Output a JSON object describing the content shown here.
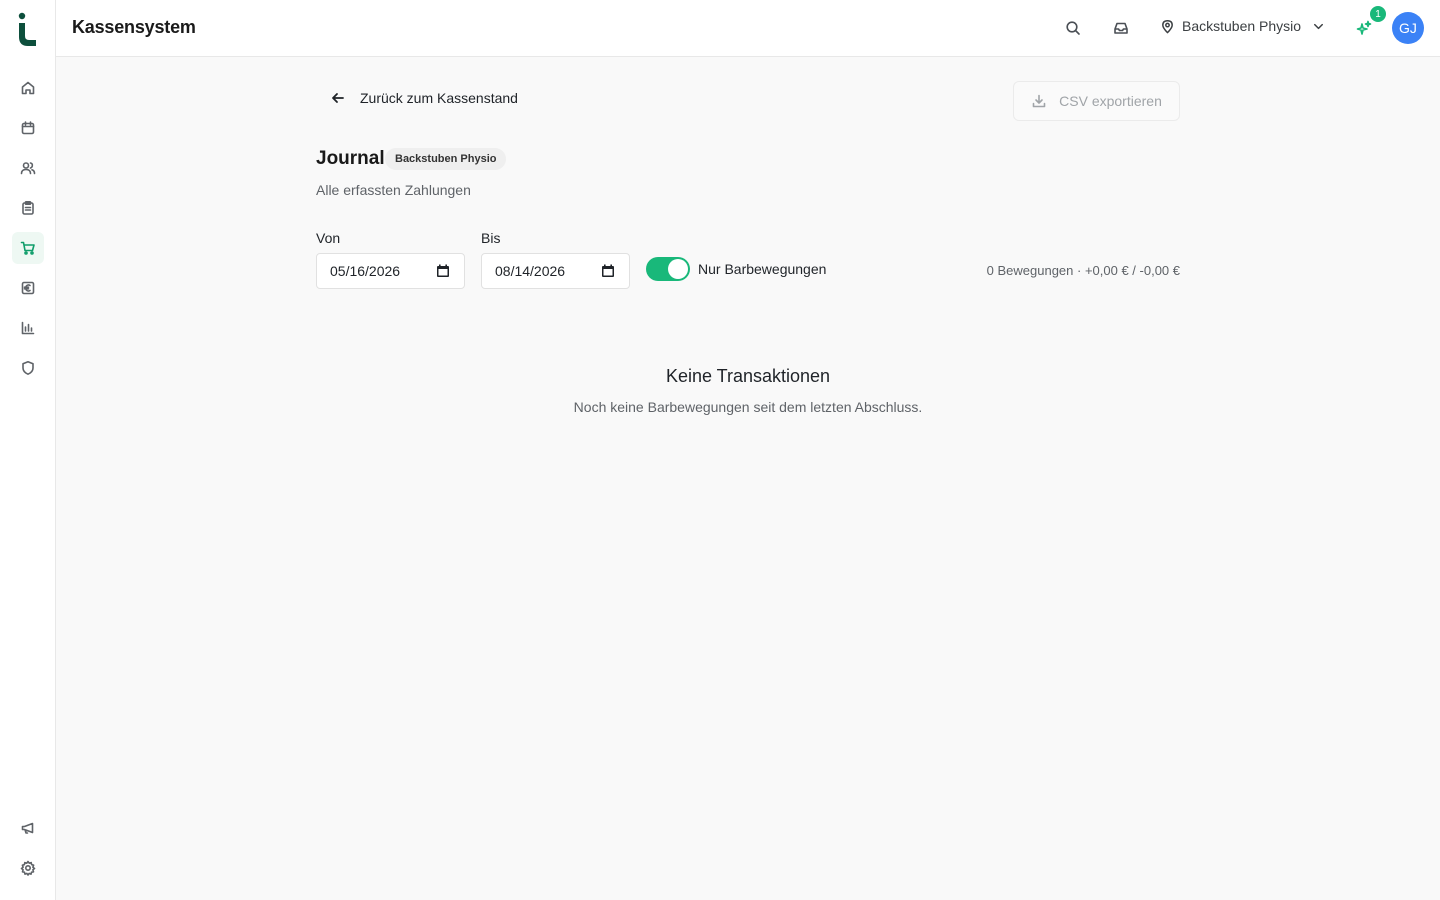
{
  "app": {
    "title": "Kassensystem"
  },
  "topbar": {
    "location": "Backstuben Physio",
    "notification_count": "1",
    "avatar_initials": "GJ"
  },
  "sidebar": {
    "items": [
      {
        "name": "home",
        "icon": "home-icon",
        "active": false
      },
      {
        "name": "calendar",
        "icon": "calendar-icon",
        "active": false
      },
      {
        "name": "patients",
        "icon": "users-icon",
        "active": false
      },
      {
        "name": "tasks",
        "icon": "clipboard-icon",
        "active": false
      },
      {
        "name": "cash-register",
        "icon": "cart-icon",
        "active": true
      },
      {
        "name": "billing",
        "icon": "euro-icon",
        "active": false
      },
      {
        "name": "reports",
        "icon": "bar-chart-icon",
        "active": false
      },
      {
        "name": "security",
        "icon": "shield-icon",
        "active": false
      }
    ],
    "bottom": [
      {
        "name": "announcements",
        "icon": "megaphone-icon"
      },
      {
        "name": "settings",
        "icon": "gear-icon"
      }
    ]
  },
  "page": {
    "back_label": "Zurück zum Kassenstand",
    "export_label": "CSV exportieren",
    "title": "Journal",
    "location_chip": "Backstuben Physio",
    "subtitle": "Alle erfassten Zahlungen"
  },
  "filters": {
    "from_label": "Von",
    "from_value": "05/16/2026",
    "to_label": "Bis",
    "to_value": "08/14/2026",
    "toggle_label": "Nur Barbewegungen",
    "toggle_on": true,
    "summary": "0 Bewegungen · +0,00 € / -0,00 €"
  },
  "empty_state": {
    "title": "Keine Transaktionen",
    "message": "Noch keine Barbewegungen seit dem letzten Abschluss."
  },
  "colors": {
    "accent": "#19b87a",
    "brand_dark": "#0d4f3c",
    "avatar": "#3b82f6"
  }
}
